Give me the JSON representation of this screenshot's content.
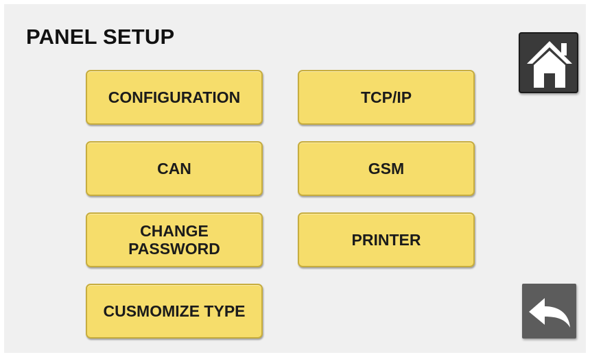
{
  "header": {
    "title": "PANEL SETUP"
  },
  "menu": {
    "configuration": "CONFIGURATION",
    "tcp_ip": "TCP/IP",
    "can": "CAN",
    "gsm": "GSM",
    "change_password": "CHANGE\nPASSWORD",
    "printer": "PRINTER",
    "customize_type": "CUSMOMIZE  TYPE"
  },
  "icons": {
    "home": "home-icon",
    "back": "back-arrow-icon"
  },
  "colors": {
    "button_fill": "#f6dd6b",
    "button_border": "#c7ad3e",
    "screen_background": "#f0f0f0",
    "icon_button_fill": "#3a3a3a"
  }
}
